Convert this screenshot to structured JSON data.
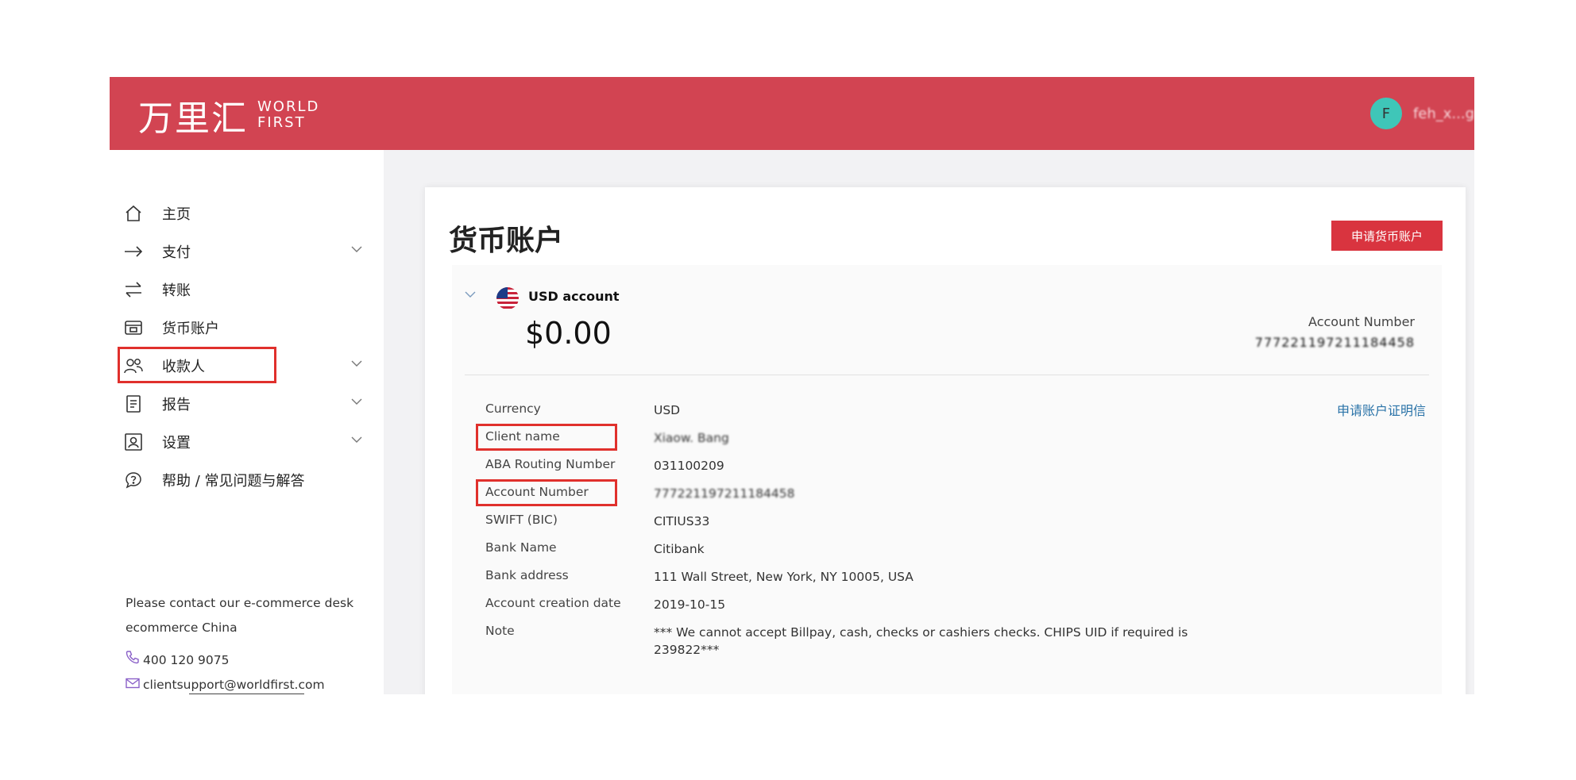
{
  "header": {
    "logo_cn": "万里汇",
    "logo_en_line1": "WORLD",
    "logo_en_line2": "FIRST",
    "user_initial": "F",
    "username": "feh_x...g"
  },
  "sidebar": {
    "items": [
      {
        "label": "主页",
        "icon": "home-icon"
      },
      {
        "label": "支付",
        "icon": "arrow-right-icon",
        "has_children": true
      },
      {
        "label": "转账",
        "icon": "transfer-icon"
      },
      {
        "label": "货币账户",
        "icon": "wallet-icon",
        "selected": true
      },
      {
        "label": "收款人",
        "icon": "users-icon",
        "has_children": true
      },
      {
        "label": "报告",
        "icon": "report-icon",
        "has_children": true
      },
      {
        "label": "设置",
        "icon": "settings-icon",
        "has_children": true
      },
      {
        "label": "帮助 / 常见问题与解答",
        "icon": "help-icon"
      }
    ],
    "contact": {
      "line1": "Please contact our e-commerce desk",
      "line2": "ecommerce China",
      "phone": "400 120 9075",
      "email": "clientsupport@worldfirst.com"
    }
  },
  "main": {
    "title": "货币账户",
    "apply_button": "申请货币账户",
    "account": {
      "name": "USD account",
      "balance": "$0.00",
      "number_label": "Account Number",
      "number_value": "777221197211184458",
      "proof_link": "申请账户证明信",
      "details": [
        {
          "label": "Currency",
          "value": "USD"
        },
        {
          "label": "Client name",
          "value": "Xiaow. Bang",
          "blurred": true,
          "highlighted": true
        },
        {
          "label": "ABA Routing Number",
          "value": "031100209"
        },
        {
          "label": "Account Number",
          "value": "777221197211184458",
          "blurred": true,
          "highlighted": true
        },
        {
          "label": "SWIFT (BIC)",
          "value": "CITIUS33"
        },
        {
          "label": "Bank Name",
          "value": "Citibank"
        },
        {
          "label": "Bank address",
          "value": "111 Wall Street, New York, NY 10005, USA"
        },
        {
          "label": "Account creation date",
          "value": "2019-10-15"
        },
        {
          "label": "Note",
          "value": "*** We cannot accept Billpay, cash, checks or cashiers checks. CHIPS UID if required is",
          "value2": "239822***"
        }
      ]
    }
  },
  "colors": {
    "brand": "#d24452",
    "button": "#d9343f",
    "highlight": "#e0302c",
    "link": "#2a73a8",
    "avatar": "#3fc6b8"
  }
}
